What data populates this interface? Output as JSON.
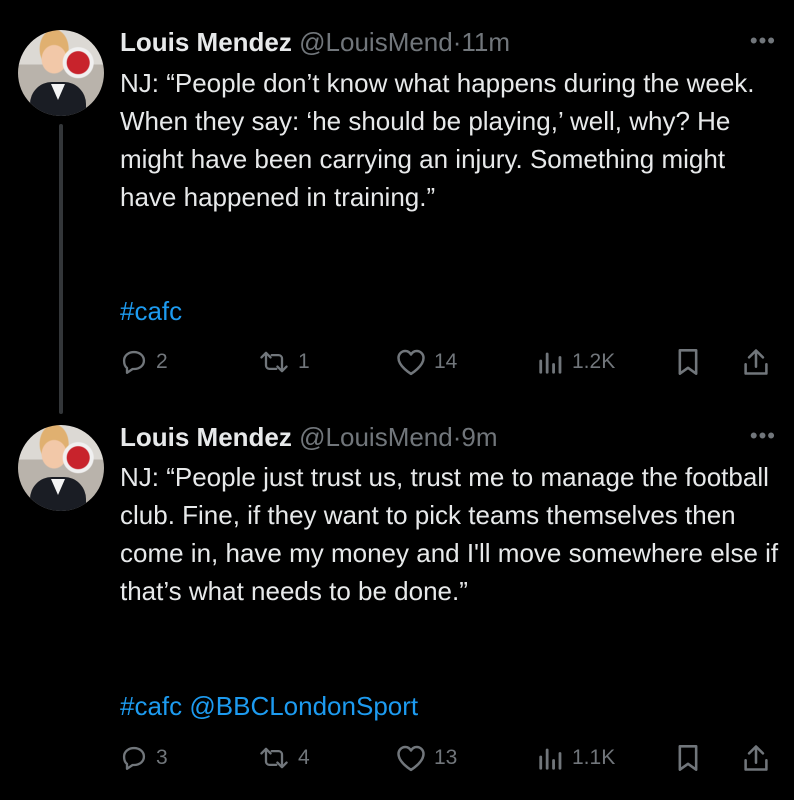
{
  "tweets": [
    {
      "name": "Louis Mendez",
      "handle": "@LouisMend",
      "separator": "·",
      "time": "11m",
      "more": "•••",
      "text": "NJ: “People don’t know what happens during the week. When they say: ‘he should be playing,’ well, why? He might have been carrying an injury. Something might have happened in training.”",
      "tags": "#cafc",
      "replies": "2",
      "retweets": "1",
      "likes": "14",
      "views": "1.2K"
    },
    {
      "name": "Louis Mendez",
      "handle": "@LouisMend",
      "separator": "·",
      "time": "9m",
      "more": "•••",
      "text": "NJ: “People just trust us, trust me to manage the football club. Fine, if they want to pick teams themselves then come in, have my money and I'll move somewhere else if that’s what needs to be done.”",
      "tags": "#cafc @BBCLondonSport",
      "replies": "3",
      "retweets": "4",
      "likes": "13",
      "views": "1.1K"
    }
  ],
  "icons": {
    "reply": "reply-icon",
    "retweet": "retweet-icon",
    "like": "heart-icon",
    "views": "views-icon",
    "bookmark": "bookmark-icon",
    "share": "share-icon"
  },
  "colors": {
    "background": "#000000",
    "text": "#e7e9ea",
    "muted": "#71767b",
    "link": "#1d9bf0",
    "thread_line": "#333639"
  }
}
